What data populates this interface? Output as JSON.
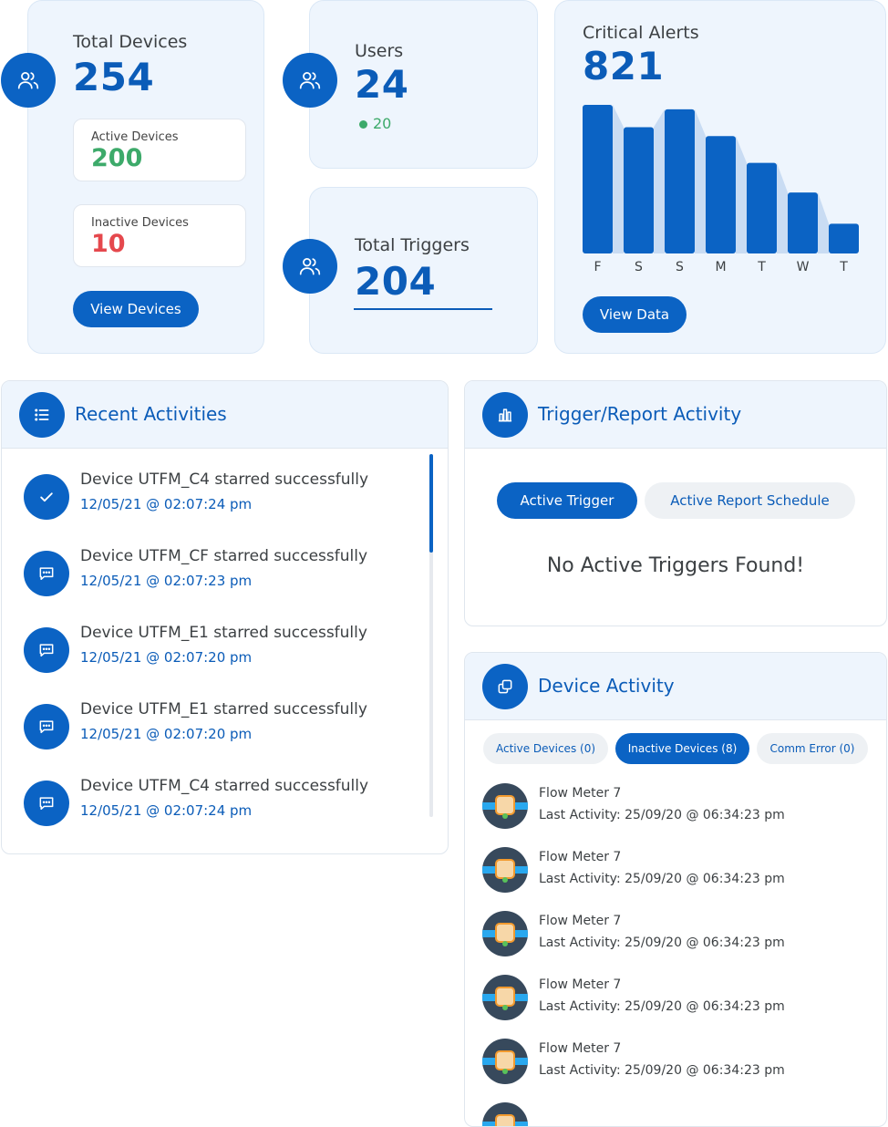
{
  "total_devices": {
    "label": "Total Devices",
    "value": "254",
    "active_label": "Active Devices",
    "active_value": "200",
    "inactive_label": "Inactive Devices",
    "inactive_value": "10",
    "button": "View Devices"
  },
  "users": {
    "label": "Users",
    "value": "24",
    "online": "20"
  },
  "total_triggers": {
    "label": "Total Triggers",
    "value": "204"
  },
  "critical_alerts": {
    "label": "Critical Alerts",
    "value": "821",
    "button": "View Data"
  },
  "chart_data": {
    "type": "bar",
    "categories": [
      "F",
      "S",
      "S",
      "M",
      "T",
      "W",
      "T"
    ],
    "values": [
      100,
      85,
      97,
      79,
      61,
      41,
      20
    ],
    "title": "",
    "xlabel": "",
    "ylabel": "",
    "ylim": [
      0,
      100
    ],
    "grid": false,
    "colors": {
      "bar": "#0b63c4",
      "shadow": "#c9dcf3"
    }
  },
  "recent_activities": {
    "title": "Recent Activities",
    "items": [
      {
        "icon": "check-icon",
        "text": "Device UTFM_C4 starred successfully",
        "time": "12/05/21 @ 02:07:24 pm"
      },
      {
        "icon": "message-icon",
        "text": "Device UTFM_CF starred successfully",
        "time": "12/05/21 @ 02:07:23 pm"
      },
      {
        "icon": "message-icon",
        "text": "Device UTFM_E1 starred successfully",
        "time": "12/05/21 @ 02:07:20 pm"
      },
      {
        "icon": "message-icon",
        "text": "Device UTFM_E1 starred successfully",
        "time": "12/05/21 @ 02:07:20 pm"
      },
      {
        "icon": "message-icon",
        "text": "Device UTFM_C4 starred successfully",
        "time": "12/05/21 @ 02:07:24 pm"
      }
    ]
  },
  "trigger_report": {
    "title": "Trigger/Report Activity",
    "tabs": [
      "Active Trigger",
      "Active Report Schedule"
    ],
    "empty_message": "No Active Triggers Found!"
  },
  "device_activity": {
    "title": "Device Activity",
    "tabs": [
      "Active Devices (0)",
      "Inactive Devices (8)",
      "Comm Error (0)"
    ],
    "items": [
      {
        "name": "Flow Meter 7",
        "last": "Last Activity: 25/09/20 @ 06:34:23 pm"
      },
      {
        "name": "Flow Meter 7",
        "last": "Last Activity: 25/09/20 @ 06:34:23 pm"
      },
      {
        "name": "Flow Meter 7",
        "last": "Last Activity: 25/09/20 @ 06:34:23 pm"
      },
      {
        "name": "Flow Meter 7",
        "last": "Last Activity: 25/09/20 @ 06:34:23 pm"
      },
      {
        "name": "Flow Meter 7",
        "last": "Last Activity: 25/09/20 @ 06:34:23 pm"
      }
    ]
  },
  "colors": {
    "primary": "#0b63c4",
    "active": "#3daa6a",
    "inactive": "#e5484d",
    "card_bg": "#eef5fd"
  }
}
